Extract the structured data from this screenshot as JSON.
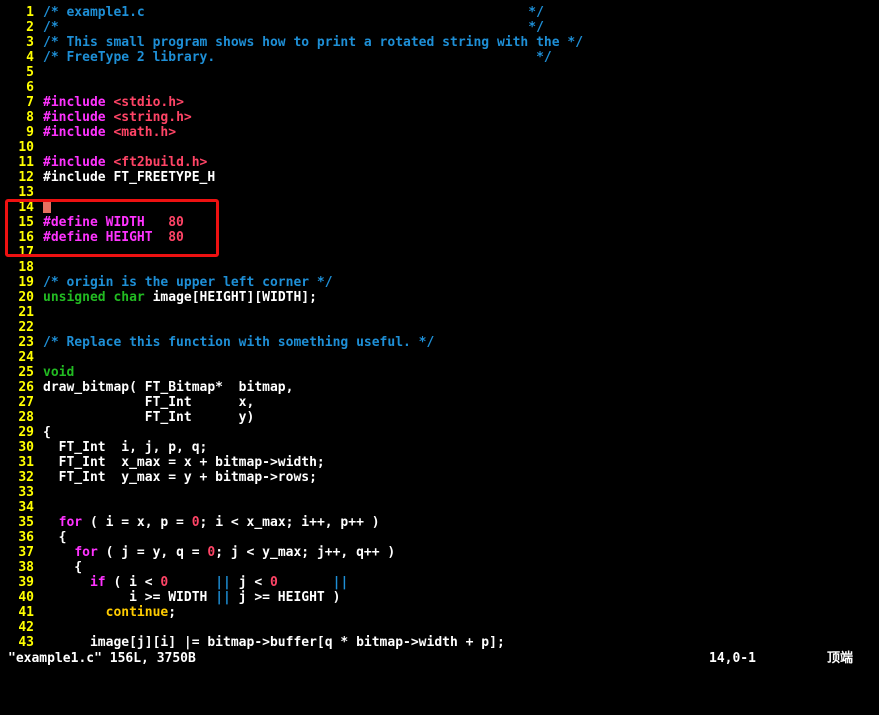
{
  "colors": {
    "background": "#000000",
    "line_number": "#ffff00",
    "highlight_box": "#ee1111",
    "cursor": "#e87060"
  },
  "editor": {
    "lines": [
      {
        "n": "1",
        "t": [
          [
            "/* example1.c                                                 */",
            "#1e8fd6"
          ]
        ]
      },
      {
        "n": "2",
        "t": [
          [
            "/*                                                            */",
            "#1e8fd6"
          ]
        ]
      },
      {
        "n": "3",
        "t": [
          [
            "/* This small program shows how to print a rotated string with the */",
            "#1e8fd6"
          ]
        ]
      },
      {
        "n": "4",
        "t": [
          [
            "/* FreeType 2 library.                                         */",
            "#1e8fd6"
          ]
        ]
      },
      {
        "n": "5",
        "t": []
      },
      {
        "n": "6",
        "t": []
      },
      {
        "n": "7",
        "t": [
          [
            "#include",
            "#ff33ff"
          ],
          [
            " ",
            "#ffffff"
          ],
          [
            "<stdio.h>",
            "#ff4466"
          ]
        ]
      },
      {
        "n": "8",
        "t": [
          [
            "#include",
            "#ff33ff"
          ],
          [
            " ",
            "#ffffff"
          ],
          [
            "<string.h>",
            "#ff4466"
          ]
        ]
      },
      {
        "n": "9",
        "t": [
          [
            "#include",
            "#ff33ff"
          ],
          [
            " ",
            "#ffffff"
          ],
          [
            "<math.h>",
            "#ff4466"
          ]
        ]
      },
      {
        "n": "10",
        "t": []
      },
      {
        "n": "11",
        "t": [
          [
            "#include",
            "#ff33ff"
          ],
          [
            " ",
            "#ffffff"
          ],
          [
            "<ft2build.h>",
            "#ff4466"
          ]
        ]
      },
      {
        "n": "12",
        "t": [
          [
            "#include FT_FREETYPE_H",
            "#ffffff"
          ]
        ]
      },
      {
        "n": "13",
        "t": []
      },
      {
        "n": "14",
        "t": [],
        "cursor": true
      },
      {
        "n": "15",
        "t": [
          [
            "#define WIDTH   ",
            "#ff33ff"
          ],
          [
            "80",
            "#ff4466"
          ]
        ]
      },
      {
        "n": "16",
        "t": [
          [
            "#define HEIGHT  ",
            "#ff33ff"
          ],
          [
            "80",
            "#ff4466"
          ]
        ]
      },
      {
        "n": "17",
        "t": []
      },
      {
        "n": "18",
        "t": []
      },
      {
        "n": "19",
        "t": [
          [
            "/* origin is the upper left corner */",
            "#1e8fd6"
          ]
        ]
      },
      {
        "n": "20",
        "t": [
          [
            "unsigned",
            "#22bb22"
          ],
          [
            " ",
            "#ffffff"
          ],
          [
            "char",
            "#22bb22"
          ],
          [
            " image[HEIGHT][WIDTH];",
            "#ffffff"
          ]
        ]
      },
      {
        "n": "21",
        "t": []
      },
      {
        "n": "22",
        "t": []
      },
      {
        "n": "23",
        "t": [
          [
            "/* Replace this function with something useful. */",
            "#1e8fd6"
          ]
        ]
      },
      {
        "n": "24",
        "t": []
      },
      {
        "n": "25",
        "t": [
          [
            "void",
            "#22bb22"
          ]
        ]
      },
      {
        "n": "26",
        "t": [
          [
            "draw_bitmap( FT_Bitmap*  bitmap,",
            "#ffffff"
          ]
        ]
      },
      {
        "n": "27",
        "t": [
          [
            "             FT_Int      x,",
            "#ffffff"
          ]
        ]
      },
      {
        "n": "28",
        "t": [
          [
            "             FT_Int      y)",
            "#ffffff"
          ]
        ]
      },
      {
        "n": "29",
        "t": [
          [
            "{",
            "#ffffff"
          ]
        ]
      },
      {
        "n": "30",
        "t": [
          [
            "  FT_Int  i, j, p, q;",
            "#ffffff"
          ]
        ]
      },
      {
        "n": "31",
        "t": [
          [
            "  FT_Int  x_max = x + bitmap->width;",
            "#ffffff"
          ]
        ]
      },
      {
        "n": "32",
        "t": [
          [
            "  FT_Int  y_max = y + bitmap->rows;",
            "#ffffff"
          ]
        ]
      },
      {
        "n": "33",
        "t": []
      },
      {
        "n": "34",
        "t": []
      },
      {
        "n": "35",
        "t": [
          [
            "  ",
            "#ffffff"
          ],
          [
            "for",
            "#ff33ff"
          ],
          [
            " ( i = x, p = ",
            "#ffffff"
          ],
          [
            "0",
            "#ff4466"
          ],
          [
            "; i < x_max; i++, p++ )",
            "#ffffff"
          ]
        ]
      },
      {
        "n": "36",
        "t": [
          [
            "  {",
            "#ffffff"
          ]
        ]
      },
      {
        "n": "37",
        "t": [
          [
            "    ",
            "#ffffff"
          ],
          [
            "for",
            "#ff33ff"
          ],
          [
            " ( j = y, q = ",
            "#ffffff"
          ],
          [
            "0",
            "#ff4466"
          ],
          [
            "; j < y_max; j++, q++ )",
            "#ffffff"
          ]
        ]
      },
      {
        "n": "38",
        "t": [
          [
            "    {",
            "#ffffff"
          ]
        ]
      },
      {
        "n": "39",
        "t": [
          [
            "      ",
            "#ffffff"
          ],
          [
            "if",
            "#ff33ff"
          ],
          [
            " ( i < ",
            "#ffffff"
          ],
          [
            "0",
            "#ff4466"
          ],
          [
            "      ",
            "#ffffff"
          ],
          [
            "||",
            "#1e8fd6"
          ],
          [
            " j < ",
            "#ffffff"
          ],
          [
            "0",
            "#ff4466"
          ],
          [
            "       ",
            "#ffffff"
          ],
          [
            "||",
            "#1e8fd6"
          ]
        ]
      },
      {
        "n": "40",
        "t": [
          [
            "           i >= WIDTH ",
            "#ffffff"
          ],
          [
            "||",
            "#1e8fd6"
          ],
          [
            " j >= HEIGHT )",
            "#ffffff"
          ]
        ]
      },
      {
        "n": "41",
        "t": [
          [
            "        ",
            "#ffffff"
          ],
          [
            "continue",
            "#ffcc00"
          ],
          [
            ";",
            "#ffffff"
          ]
        ]
      },
      {
        "n": "42",
        "t": []
      },
      {
        "n": "43",
        "t": [
          [
            "      image[j][i] |= bitmap->buffer[q * bitmap->width + p];",
            "#ffffff"
          ]
        ]
      }
    ]
  },
  "statusline": {
    "file_info": "\"example1.c\" 156L, 3750B",
    "cursor_position": "14,0-1",
    "scroll_position": "顶端"
  }
}
